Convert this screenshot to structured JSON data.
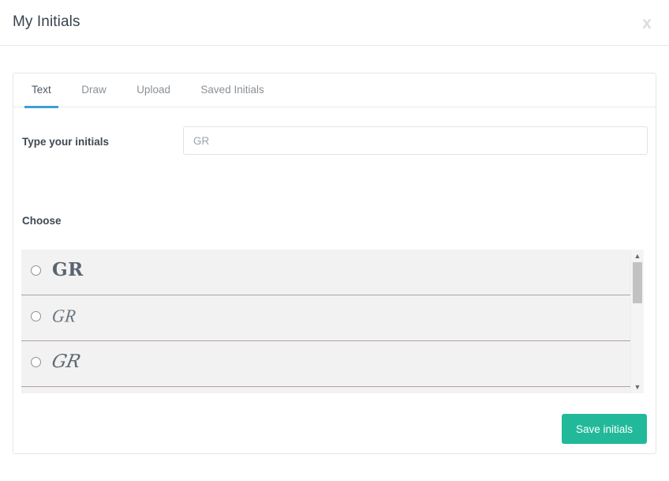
{
  "header": {
    "title": "My Initials",
    "close_label": "x"
  },
  "tabs": [
    {
      "label": "Text",
      "active": true
    },
    {
      "label": "Draw",
      "active": false
    },
    {
      "label": "Upload",
      "active": false
    },
    {
      "label": "Saved Initials",
      "active": false
    }
  ],
  "form": {
    "initials_label": "Type your initials",
    "initials_value": "",
    "initials_placeholder": "GR",
    "choose_label": "Choose"
  },
  "choices": [
    {
      "text": "GR",
      "style": "serif-bold",
      "selected": false
    },
    {
      "text": "GR",
      "style": "script-light",
      "selected": false
    },
    {
      "text": "GR",
      "style": "script-italic",
      "selected": false
    }
  ],
  "scrollbar": {
    "up_arrow": "▲",
    "down_arrow": "▼"
  },
  "footer": {
    "save_label": "Save initials"
  },
  "colors": {
    "accent_tab": "#3f9fd2",
    "save_button": "#22b99a",
    "row_divider": "#b5a0a0",
    "list_background": "#f2f2f2"
  }
}
